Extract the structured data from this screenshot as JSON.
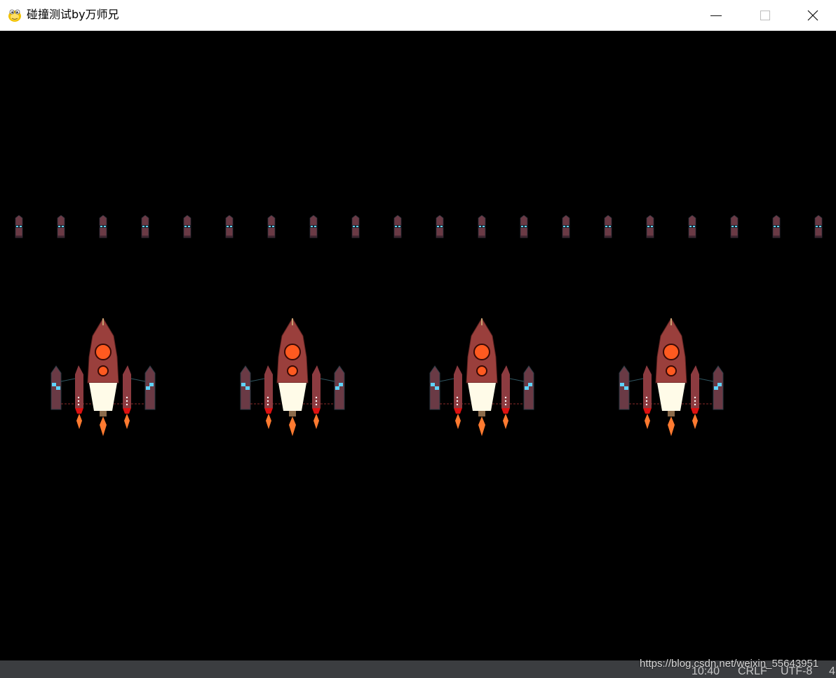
{
  "window": {
    "title": "碰撞测试by万师兄",
    "app_icon": "pygame-snake-icon",
    "controls": [
      "minimize",
      "maximize",
      "close"
    ]
  },
  "game": {
    "background": "#000000",
    "enemy_small_count": 20,
    "player_ship_count": 4
  },
  "status_bar": {
    "cursor": "10:40",
    "line_ending": "CRLF",
    "encoding": "UTF-8",
    "indent": "4"
  },
  "watermark": "https://blog.csdn.net/weixin_55643951"
}
